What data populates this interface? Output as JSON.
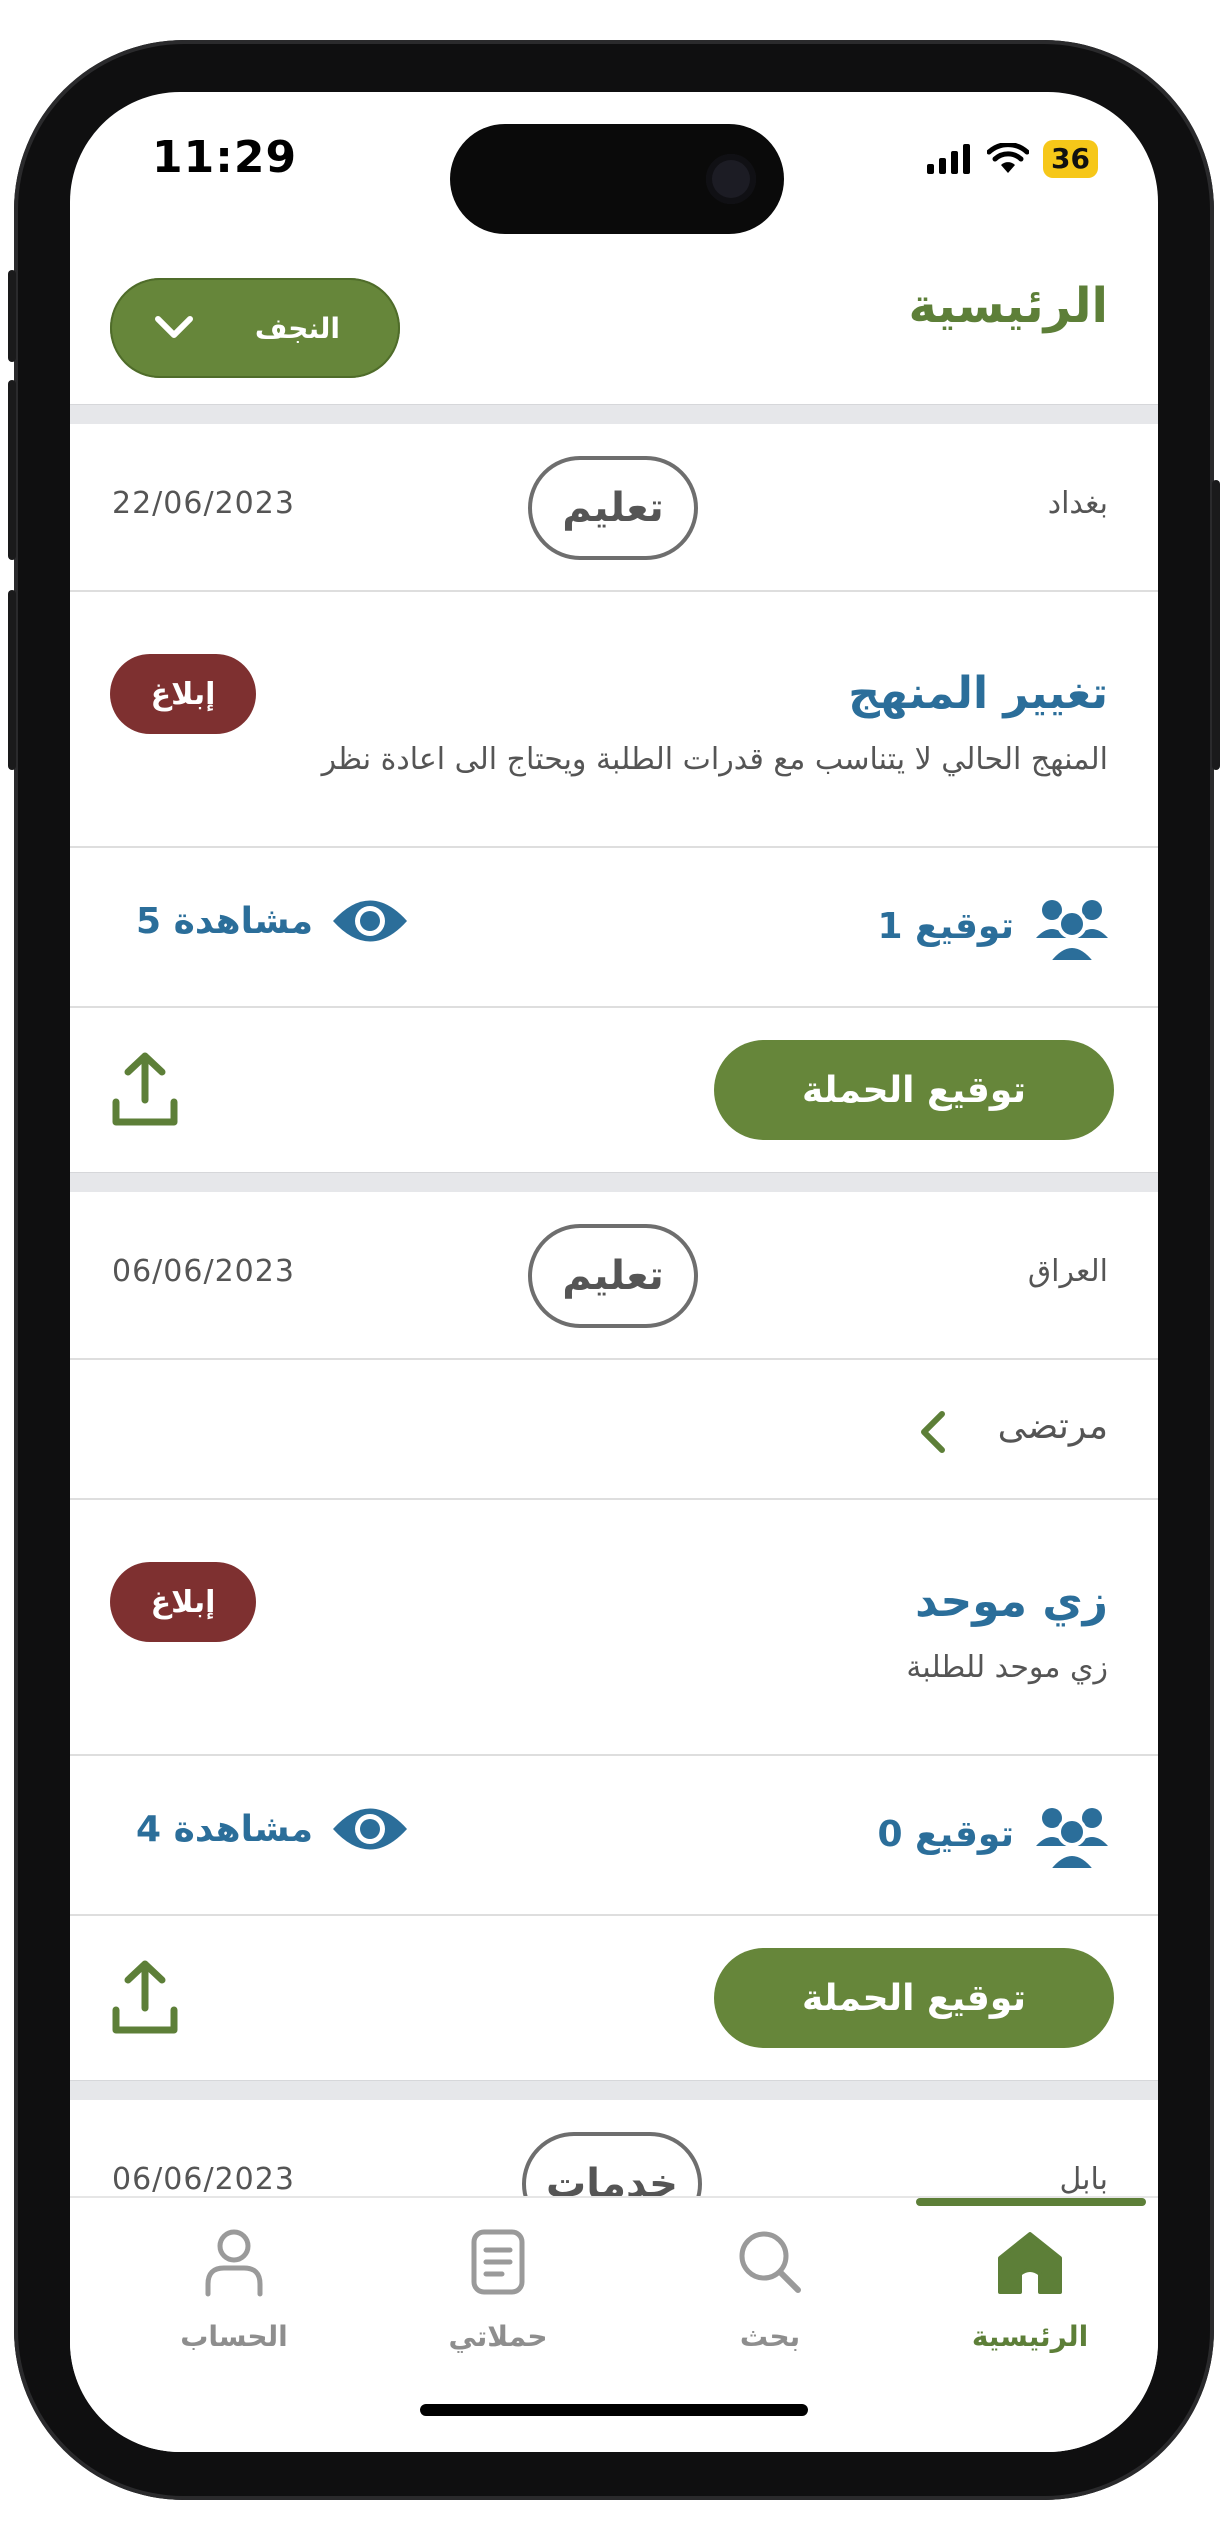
{
  "status_bar": {
    "time": "11:29",
    "battery": "36"
  },
  "header": {
    "title": "الرئيسية",
    "city": "النجف"
  },
  "campaigns": [
    {
      "place": "بغداد",
      "category": "تعليم",
      "date": "22/06/2023",
      "author": null,
      "title": "تغيير المنهج",
      "description": "المنهج الحالي لا يتناسب مع قدرات الطلبة ويحتاج الى اعادة نظر",
      "report_label": "إبلاغ",
      "signatures": "1 توقيع",
      "views": "5 مشاهدة",
      "sign_button": "توقيع الحملة"
    },
    {
      "place": "العراق",
      "category": "تعليم",
      "date": "06/06/2023",
      "author": "مرتضى",
      "title": "زي موحد",
      "description": "زي موحد للطلبة",
      "report_label": "إبلاغ",
      "signatures": "0 توقيع",
      "views": "4 مشاهدة",
      "sign_button": "توقيع الحملة"
    },
    {
      "place": "بابل",
      "category": "خدمات",
      "date": "06/06/2023"
    }
  ],
  "tabbar": {
    "home": "الرئيسية",
    "search": "بحث",
    "my_campaigns": "حملاتي",
    "account": "الحساب"
  },
  "colors": {
    "brand_green": "#66863a",
    "title_blue": "#2b6e9a",
    "report_red": "#7e3030"
  },
  "icons": [
    "signal-icon",
    "wifi-icon",
    "battery-icon",
    "chevron-down-icon",
    "chevron-left-icon",
    "people-icon",
    "eye-icon",
    "share-icon",
    "home-icon",
    "search-icon",
    "document-icon",
    "person-icon"
  ]
}
